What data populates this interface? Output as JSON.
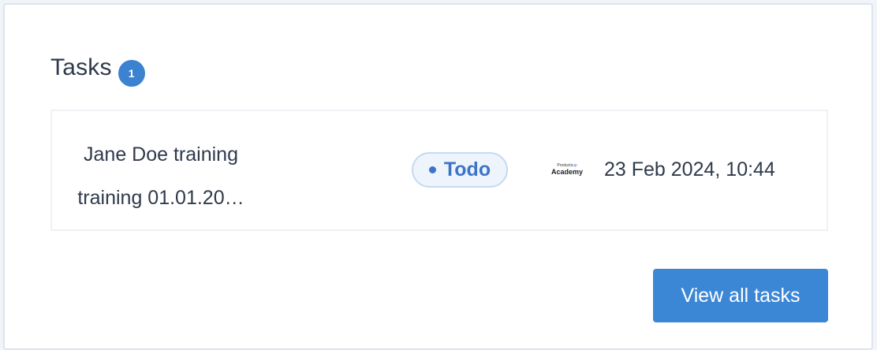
{
  "tasks_panel": {
    "title": "Tasks",
    "count": "1",
    "items": [
      {
        "name_line1": "Jane Doe training",
        "name_line2": "training 01.01.20…",
        "status": "Todo",
        "organization_logo": {
          "top_text": "Products",
          "top_mark": "up",
          "bottom_text": "Academy"
        },
        "date": "23 Feb 2024, 10:44"
      }
    ],
    "view_all_label": "View all tasks"
  },
  "colors": {
    "accent": "#3b87d6",
    "badge": "#3b82d0",
    "status_text": "#3b74c9",
    "status_bg": "#eef4fc",
    "status_border": "#c6daf2",
    "text": "#2f3a4b"
  }
}
